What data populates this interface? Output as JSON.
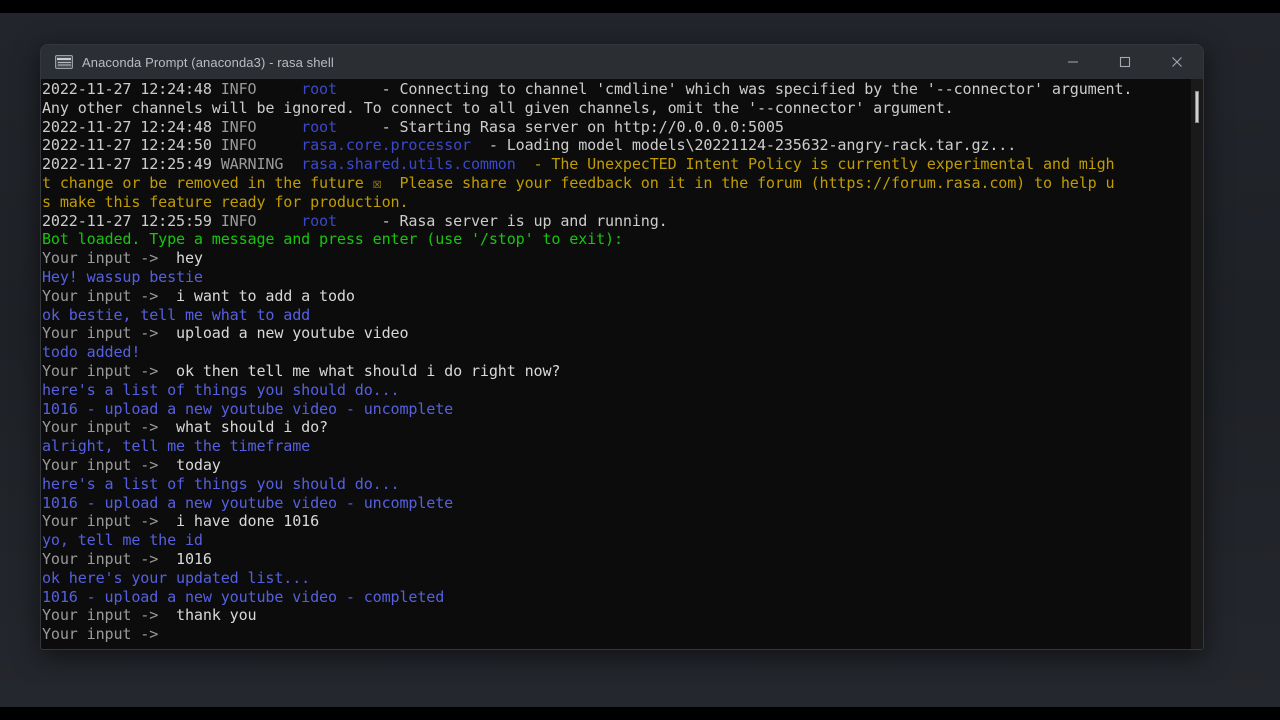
{
  "window": {
    "title": "Anaconda Prompt (anaconda3) - rasa  shell",
    "icon": "console-icon",
    "controls": {
      "minimize_label": "Minimize",
      "maximize_label": "Maximize",
      "close_label": "Close"
    }
  },
  "colors": {
    "background": "#0c0c0c",
    "white": "#cccccc",
    "dim_gray": "#9a9a9a",
    "blue": "#3b48cc",
    "bright_blue": "#5560e0",
    "yellow": "#c19c00",
    "green": "#16c60c",
    "titlebar": "#2b2e33",
    "desktop": "#1e2126"
  },
  "terminal": {
    "lines": [
      {
        "id": "log-1",
        "segments": [
          {
            "text": "2022-11-27 12:24:48 ",
            "color": "white"
          },
          {
            "text": "INFO     ",
            "color": "dim"
          },
          {
            "text": "root ",
            "color": "blue"
          },
          {
            "text": "    - Connecting to channel 'cmdline' which was specified by the '--connector' argument.",
            "color": "white"
          }
        ]
      },
      {
        "id": "log-2",
        "segments": [
          {
            "text": "Any other channels will be ignored. To connect to all given channels, omit the '--connector' argument.",
            "color": "white"
          }
        ]
      },
      {
        "id": "log-3",
        "segments": [
          {
            "text": "2022-11-27 12:24:48 ",
            "color": "white"
          },
          {
            "text": "INFO     ",
            "color": "dim"
          },
          {
            "text": "root ",
            "color": "blue"
          },
          {
            "text": "    - Starting Rasa server on http://0.0.0.0:5005",
            "color": "white"
          }
        ]
      },
      {
        "id": "log-4",
        "segments": [
          {
            "text": "2022-11-27 12:24:50 ",
            "color": "white"
          },
          {
            "text": "INFO     ",
            "color": "dim"
          },
          {
            "text": "rasa.core.processor ",
            "color": "blue"
          },
          {
            "text": " - Loading model models\\20221124-235632-angry-rack.tar.gz...",
            "color": "white"
          }
        ]
      },
      {
        "id": "log-5",
        "segments": [
          {
            "text": "2022-11-27 12:25:49 ",
            "color": "white"
          },
          {
            "text": "WARNING  ",
            "color": "dim"
          },
          {
            "text": "rasa.shared.utils.common ",
            "color": "blue"
          },
          {
            "text": " - The UnexpecTED Intent Policy is currently experimental and migh",
            "color": "yellow"
          }
        ]
      },
      {
        "id": "log-6",
        "segments": [
          {
            "text": "t change or be removed in the future ☒  Please share your feedback on it in the forum (https://forum.rasa.com) to help u",
            "color": "yellow"
          }
        ]
      },
      {
        "id": "log-7",
        "segments": [
          {
            "text": "s make this feature ready for production.",
            "color": "yellow"
          }
        ]
      },
      {
        "id": "log-8",
        "segments": [
          {
            "text": "2022-11-27 12:25:59 ",
            "color": "white"
          },
          {
            "text": "INFO     ",
            "color": "dim"
          },
          {
            "text": "root ",
            "color": "blue"
          },
          {
            "text": "    - Rasa server is up and running.",
            "color": "white"
          }
        ]
      },
      {
        "id": "bot-loaded",
        "segments": [
          {
            "text": "Bot loaded. Type a message and press enter (use '/stop' to exit):",
            "color": "green"
          }
        ]
      },
      {
        "id": "turn-1-user",
        "segments": [
          {
            "text": "Your input ->",
            "color": "dim"
          },
          {
            "text": "  hey",
            "color": "userin"
          }
        ]
      },
      {
        "id": "turn-1-bot",
        "segments": [
          {
            "text": "Hey! wassup bestie",
            "color": "blue-b"
          }
        ]
      },
      {
        "id": "turn-2-user",
        "segments": [
          {
            "text": "Your input ->",
            "color": "dim"
          },
          {
            "text": "  i want to add a todo",
            "color": "userin"
          }
        ]
      },
      {
        "id": "turn-2-bot",
        "segments": [
          {
            "text": "ok bestie, tell me what to add",
            "color": "blue-b"
          }
        ]
      },
      {
        "id": "turn-3-user",
        "segments": [
          {
            "text": "Your input ->",
            "color": "dim"
          },
          {
            "text": "  upload a new youtube video",
            "color": "userin"
          }
        ]
      },
      {
        "id": "turn-3-bot",
        "segments": [
          {
            "text": "todo added!",
            "color": "blue-b"
          }
        ]
      },
      {
        "id": "turn-4-user",
        "segments": [
          {
            "text": "Your input ->",
            "color": "dim"
          },
          {
            "text": "  ok then tell me what should i do right now?",
            "color": "userin"
          }
        ]
      },
      {
        "id": "turn-4-bot-a",
        "segments": [
          {
            "text": "here's a list of things you should do...",
            "color": "blue-b"
          }
        ]
      },
      {
        "id": "turn-4-bot-b",
        "segments": [
          {
            "text": "1016 - upload a new youtube video - uncomplete",
            "color": "blue-b"
          }
        ]
      },
      {
        "id": "turn-5-user",
        "segments": [
          {
            "text": "Your input ->",
            "color": "dim"
          },
          {
            "text": "  what should i do?",
            "color": "userin"
          }
        ]
      },
      {
        "id": "turn-5-bot",
        "segments": [
          {
            "text": "alright, tell me the timeframe",
            "color": "blue-b"
          }
        ]
      },
      {
        "id": "turn-6-user",
        "segments": [
          {
            "text": "Your input ->",
            "color": "dim"
          },
          {
            "text": "  today",
            "color": "userin"
          }
        ]
      },
      {
        "id": "turn-6-bot-a",
        "segments": [
          {
            "text": "here's a list of things you should do...",
            "color": "blue-b"
          }
        ]
      },
      {
        "id": "turn-6-bot-b",
        "segments": [
          {
            "text": "1016 - upload a new youtube video - uncomplete",
            "color": "blue-b"
          }
        ]
      },
      {
        "id": "turn-7-user",
        "segments": [
          {
            "text": "Your input ->",
            "color": "dim"
          },
          {
            "text": "  i have done 1016",
            "color": "userin"
          }
        ]
      },
      {
        "id": "turn-7-bot",
        "segments": [
          {
            "text": "yo, tell me the id",
            "color": "blue-b"
          }
        ]
      },
      {
        "id": "turn-8-user",
        "segments": [
          {
            "text": "Your input ->",
            "color": "dim"
          },
          {
            "text": "  1016",
            "color": "userin"
          }
        ]
      },
      {
        "id": "turn-8-bot-a",
        "segments": [
          {
            "text": "ok here's your updated list...",
            "color": "blue-b"
          }
        ]
      },
      {
        "id": "turn-8-bot-b",
        "segments": [
          {
            "text": "1016 - upload a new youtube video - completed",
            "color": "blue-b"
          }
        ]
      },
      {
        "id": "turn-9-user",
        "segments": [
          {
            "text": "Your input ->",
            "color": "dim"
          },
          {
            "text": "  thank you",
            "color": "userin"
          }
        ]
      },
      {
        "id": "prompt-active",
        "segments": [
          {
            "text": "Your input ->",
            "color": "dim"
          },
          {
            "text": " ",
            "color": "userin"
          }
        ]
      }
    ]
  }
}
